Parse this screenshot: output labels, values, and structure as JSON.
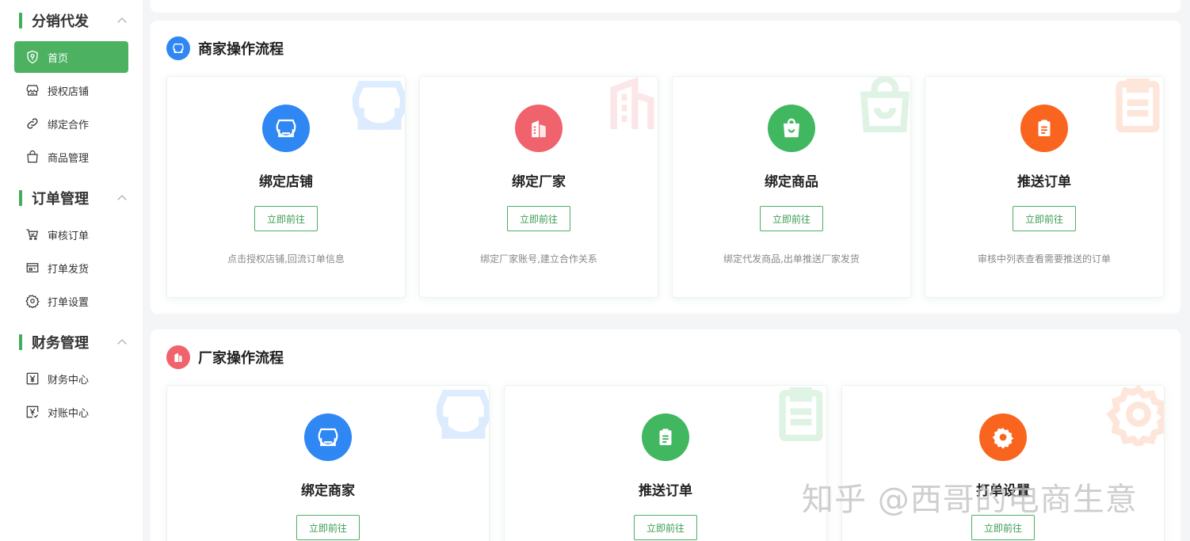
{
  "sidebar": {
    "groups": [
      {
        "title": "分销代发",
        "items": [
          {
            "label": "首页",
            "icon": "shield-icon",
            "active": true
          },
          {
            "label": "授权店铺",
            "icon": "store-icon"
          },
          {
            "label": "绑定合作",
            "icon": "link-icon"
          },
          {
            "label": "商品管理",
            "icon": "bag-icon"
          }
        ]
      },
      {
        "title": "订单管理",
        "items": [
          {
            "label": "审核订单",
            "icon": "cart-icon"
          },
          {
            "label": "打单发货",
            "icon": "printer-icon"
          },
          {
            "label": "打单设置",
            "icon": "gear-icon"
          }
        ]
      },
      {
        "title": "财务管理",
        "items": [
          {
            "label": "财务中心",
            "icon": "yen-icon"
          },
          {
            "label": "对账中心",
            "icon": "yen-check-icon"
          }
        ]
      }
    ]
  },
  "merchant": {
    "title": "商家操作流程",
    "cards": [
      {
        "title": "绑定店铺",
        "button": "立即前往",
        "desc": "点击授权店铺,回流订单信息",
        "icon": "store-icon",
        "color": "#2f87f4"
      },
      {
        "title": "绑定厂家",
        "button": "立即前往",
        "desc": "绑定厂家账号,建立合作关系",
        "icon": "building-icon",
        "color": "#f0636c"
      },
      {
        "title": "绑定商品",
        "button": "立即前往",
        "desc": "绑定代发商品,出单推送厂家发货",
        "icon": "bag-icon",
        "color": "#41b760"
      },
      {
        "title": "推送订单",
        "button": "立即前往",
        "desc": "审核中列表查看需要推送的订单",
        "icon": "clipboard-icon",
        "color": "#f9651f"
      }
    ]
  },
  "factory": {
    "title": "厂家操作流程",
    "cards": [
      {
        "title": "绑定商家",
        "button": "立即前往",
        "icon": "store-icon",
        "color": "#2f87f4"
      },
      {
        "title": "推送订单",
        "button": "立即前往",
        "icon": "clipboard-icon",
        "color": "#41b760"
      },
      {
        "title": "打单设置",
        "button": "立即前往",
        "icon": "gear-icon",
        "color": "#f9651f"
      }
    ]
  },
  "watermark": "知乎 @西哥的电商生意"
}
